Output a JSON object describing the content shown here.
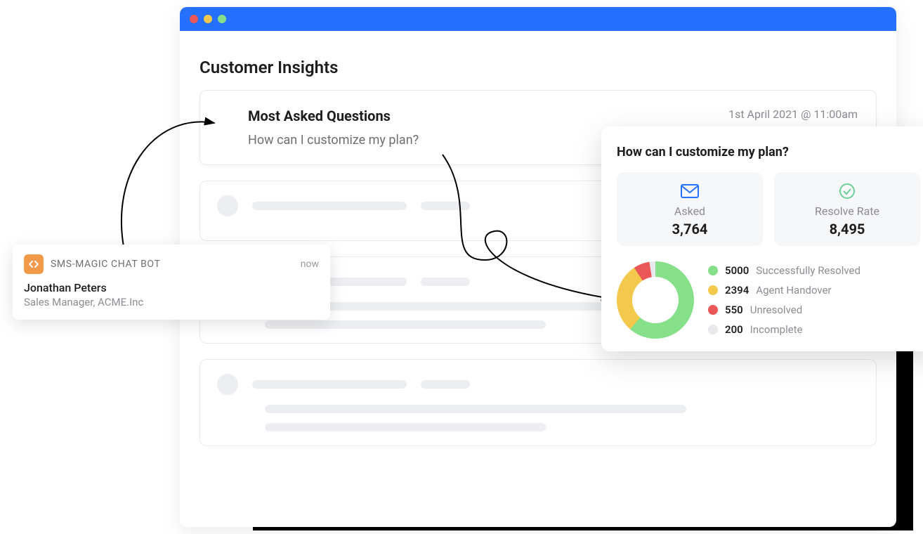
{
  "page": {
    "heading": "Customer Insights",
    "main_card": {
      "title": "Most Asked Questions",
      "example": "How can I customize my plan?",
      "timestamp": "1st April 2021 @ 11:00am"
    }
  },
  "detail": {
    "title": "How can I customize my plan?",
    "stats": [
      {
        "label": "Asked",
        "value": "3,764",
        "icon": "mail-icon",
        "color": "#2670FF"
      },
      {
        "label": "Resolve Rate",
        "value": "8,495",
        "icon": "check-circle-icon",
        "color": "#6FCF97"
      }
    ]
  },
  "chart_data": {
    "type": "pie",
    "series": [
      {
        "name": "Successfully Resolved",
        "value": 5000,
        "color": "#85E089"
      },
      {
        "name": "Agent Handover",
        "value": 2394,
        "color": "#F2C94C"
      },
      {
        "name": "Unresolved",
        "value": 550,
        "color": "#EB5757"
      },
      {
        "name": "Incomplete",
        "value": 200,
        "color": "#E9E9EC"
      }
    ]
  },
  "toast": {
    "app": "SMS-MAGIC CHAT BOT",
    "time": "now",
    "name": "Jonathan Peters",
    "role": "Sales Manager, ACME.Inc"
  }
}
